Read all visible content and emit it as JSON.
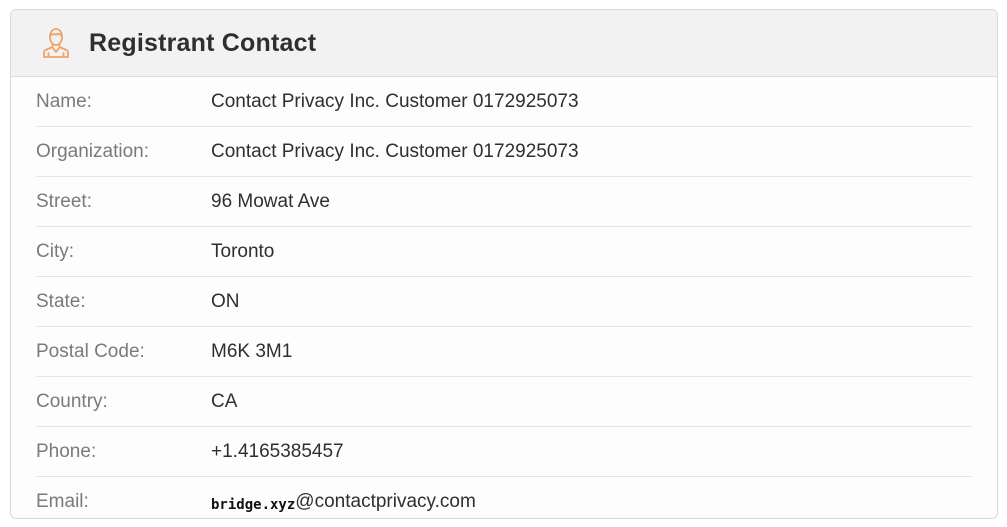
{
  "section": {
    "title": "Registrant Contact",
    "icon": "person-icon",
    "accent_color": "#f0a36a"
  },
  "rows": [
    {
      "label": "Name:",
      "value": "Contact Privacy Inc. Customer 0172925073"
    },
    {
      "label": "Organization:",
      "value": "Contact Privacy Inc. Customer 0172925073"
    },
    {
      "label": "Street:",
      "value": "96 Mowat Ave"
    },
    {
      "label": "City:",
      "value": "Toronto"
    },
    {
      "label": "State:",
      "value": "ON"
    },
    {
      "label": "Postal Code:",
      "value": "M6K 3M1"
    },
    {
      "label": "Country:",
      "value": "CA"
    },
    {
      "label": "Phone:",
      "value": "+1.4165385457"
    },
    {
      "label": "Email:",
      "value_user": "bridge.xyz",
      "value_domain": "@contactprivacy.com"
    }
  ]
}
